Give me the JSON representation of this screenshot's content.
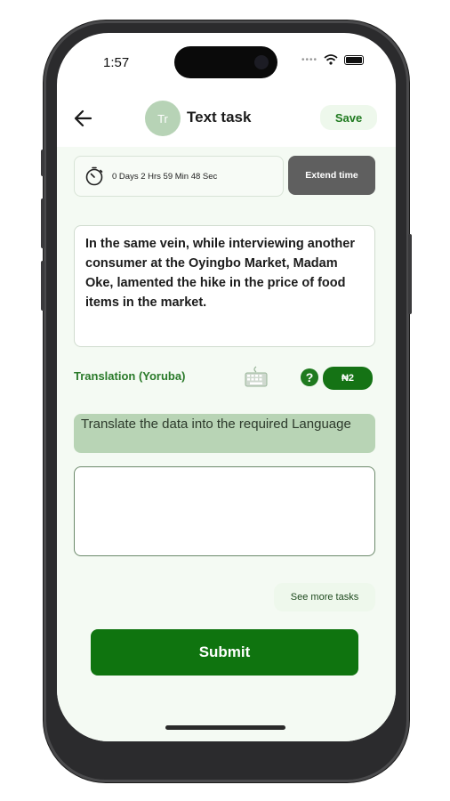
{
  "status_bar": {
    "time": "1:57"
  },
  "header": {
    "avatar_initials": "Tr",
    "title": "Text task",
    "save_label": "Save"
  },
  "timer": {
    "text": "0 Days 2 Hrs 59 Min 48 Sec",
    "extend_label": "Extend time"
  },
  "source_text": "In the same vein, while interviewing another consumer at the Oyingbo Market, Madam Oke, lamented the hike in the price of food items in the market.",
  "translation": {
    "label": "Translation (Yoruba)",
    "help_symbol": "?",
    "reward": "₦2"
  },
  "instruction": "Translate the data into the required Language",
  "answer": {
    "value": "",
    "placeholder": ""
  },
  "see_more_label": "See more tasks",
  "submit_label": "Submit",
  "colors": {
    "primary_green": "#0f740f",
    "light_green": "#eef8ec",
    "instruction_bg": "#b8d4b5",
    "content_bg": "#f4faf3",
    "extend_btn": "#5f5f5f"
  },
  "icons": [
    "back-arrow-icon",
    "timer-icon",
    "keyboard-icon",
    "help-icon",
    "wifi-icon",
    "battery-icon"
  ]
}
